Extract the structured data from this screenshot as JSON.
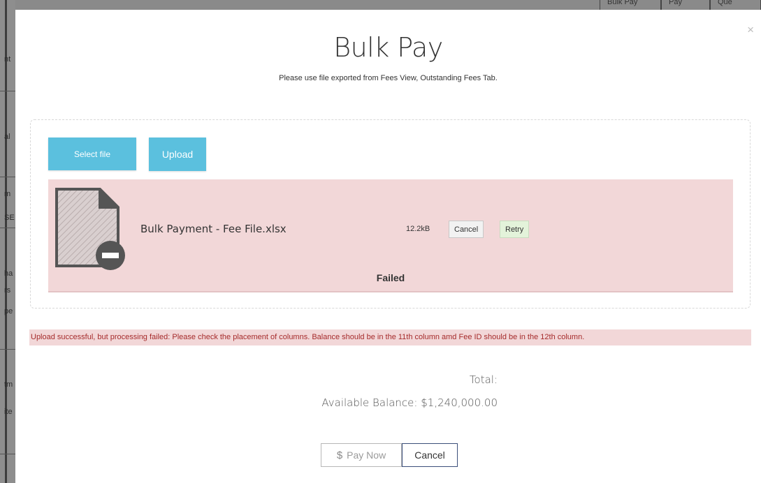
{
  "modal": {
    "title": "Bulk Pay",
    "subtitle": "Please use file exported from Fees View, Outstanding Fees Tab.",
    "close_icon": "×"
  },
  "dropzone": {
    "select_file_label": "Select file",
    "upload_label": "Upload",
    "file": {
      "name": "Bulk Payment - Fee File.xlsx",
      "size": "12.2kB",
      "cancel_label": "Cancel",
      "retry_label": "Retry",
      "status": "Failed",
      "icon": "file-remove-icon"
    }
  },
  "error_message": "Upload successful, but processing failed: Please check the placement of columns. Balance should be in the 11th column amd Fee ID should be in the 12th column.",
  "summary": {
    "total_label": "Total:",
    "available_balance_label": "Available Balance:",
    "available_balance_value": "$1,240,000.00"
  },
  "actions": {
    "pay_now_icon": "$",
    "pay_now_label": "Pay Now",
    "cancel_label": "Cancel"
  },
  "background": {
    "top_tabs": [
      "Bulk Pay",
      "Pay",
      "Que"
    ],
    "left_fragments": [
      "nt",
      "al",
      "m",
      "SE",
      "ha",
      "rs",
      "pe",
      "tm",
      "ite"
    ]
  },
  "colors": {
    "info_button": "#5bc0de",
    "error_bg": "#f2d7d8",
    "error_text": "#a52b2b",
    "retry_bg": "#e3f3da"
  }
}
